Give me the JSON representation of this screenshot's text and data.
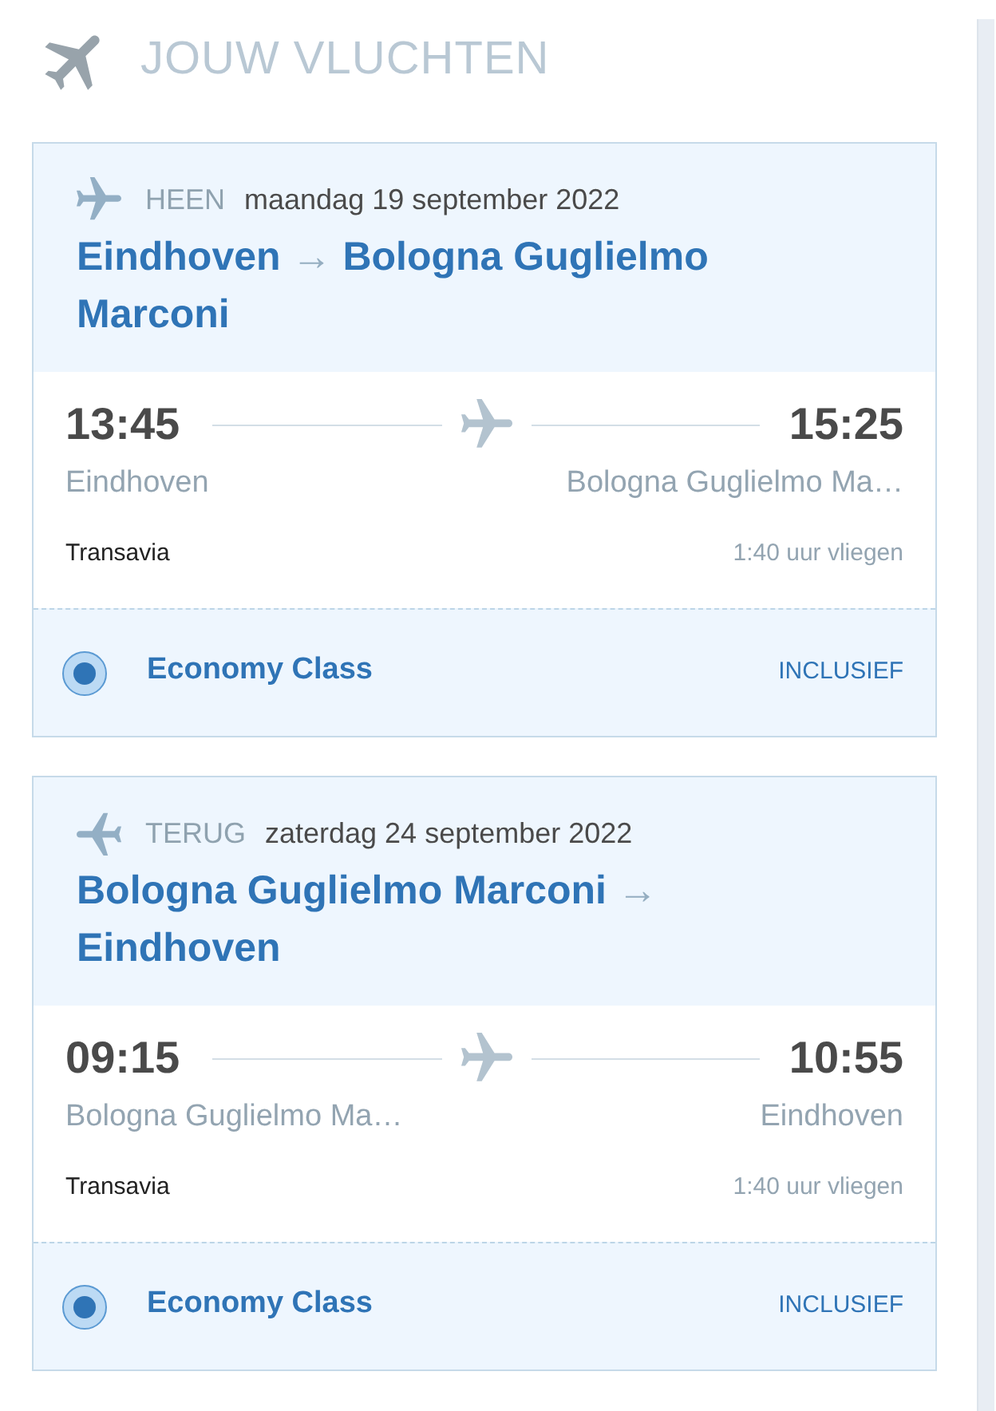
{
  "header": {
    "title": "JOUW VLUCHTEN"
  },
  "legs": [
    {
      "kind": "outbound",
      "label": "HEEN",
      "date": "maandag 19 september 2022",
      "route": {
        "origin": "Eindhoven",
        "arrow": "→",
        "destination": "Bologna Guglielmo Marconi"
      },
      "departure_time": "13:45",
      "arrival_time": "15:25",
      "departure_city": "Eindhoven",
      "arrival_city": "Bologna Guglielmo Ma…",
      "airline": "Transavia",
      "duration": "1:40 uur vliegen",
      "fare": {
        "name": "Economy Class",
        "selected": true,
        "price": "INCLUSIEF"
      }
    },
    {
      "kind": "return",
      "label": "TERUG",
      "date": "zaterdag 24 september 2022",
      "route": {
        "origin": "Bologna Guglielmo Marconi",
        "arrow": "→",
        "destination": "Eindhoven"
      },
      "departure_time": "09:15",
      "arrival_time": "10:55",
      "departure_city": "Bologna Guglielmo Ma…",
      "arrival_city": "Eindhoven",
      "airline": "Transavia",
      "duration": "1:40 uur vliegen",
      "fare": {
        "name": "Economy Class",
        "selected": true,
        "price": "INCLUSIEF"
      }
    }
  ]
}
